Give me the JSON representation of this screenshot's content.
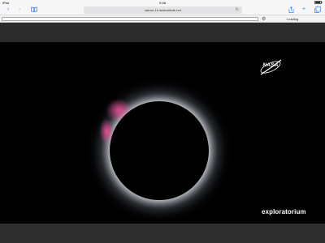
{
  "status_bar": {
    "carrier": "iPad",
    "time": "9:38"
  },
  "browser": {
    "url": "saturn-1h.skoinstitute.net",
    "loading_label": "Loading",
    "icons": {
      "back": "chevron-left-icon",
      "forward": "chevron-right-icon",
      "bookmarks": "book-icon",
      "reload": "reload-icon",
      "share": "share-icon",
      "new_tab": "plus-icon",
      "tabs": "tabs-icon",
      "settings": "gear-icon"
    }
  },
  "video": {
    "nasa_logo": "NASA",
    "exploratorium_logo": "exploratorium"
  },
  "colors": {
    "accent": "#2f7df6",
    "chrome": "#f7f7f7",
    "band": "#2c2c2c"
  }
}
